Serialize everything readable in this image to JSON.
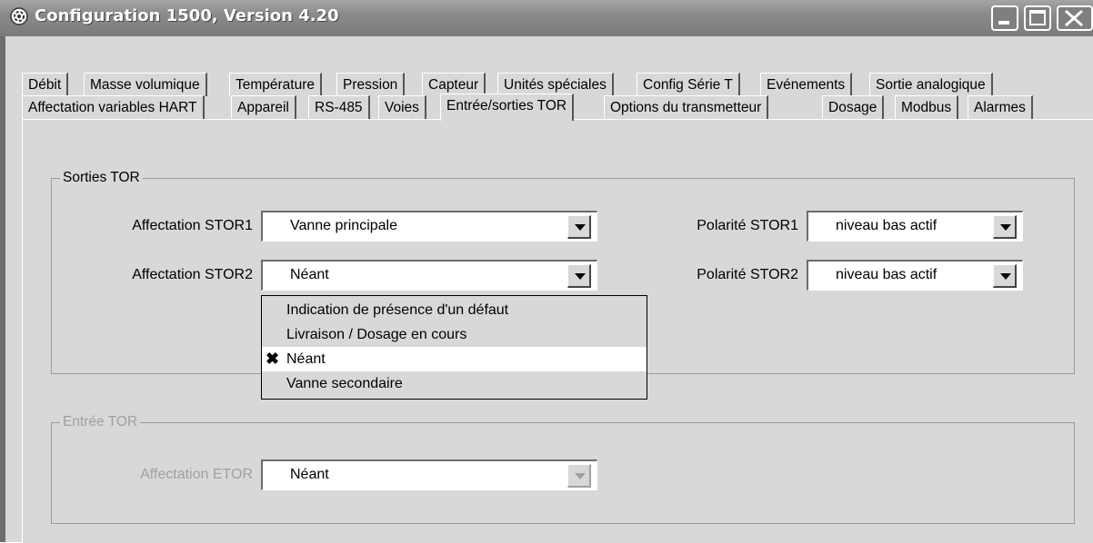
{
  "window": {
    "title": "Configuration 1500, Version 4.20",
    "icon": "gear-icon",
    "buttons": [
      "minimize-icon",
      "maximize-icon",
      "close-icon"
    ]
  },
  "tabs": {
    "row1": [
      "Débit",
      "Masse volumique",
      "Température",
      "Pression",
      "Capteur",
      "Unités spéciales",
      "Config Série T",
      "Evénements",
      "Sortie analogique"
    ],
    "row2": [
      "Affectation variables HART",
      "Appareil",
      "RS-485",
      "Voies",
      "Entrée/sorties TOR",
      "Options du transmetteur",
      "Dosage",
      "Modbus",
      "Alarmes"
    ],
    "active": "Entrée/sorties TOR"
  },
  "sorties": {
    "group_label": "Sorties TOR",
    "stor1_label": "Affectation STOR1",
    "stor1_value": "Vanne principale",
    "stor2_label": "Affectation STOR2",
    "stor2_value": "Néant",
    "pol1_label": "Polarité STOR1",
    "pol1_value": "niveau bas actif",
    "pol2_label": "Polarité STOR2",
    "pol2_value": "niveau bas actif"
  },
  "dropdown": {
    "options": [
      "Indication de présence d'un défaut",
      "Livraison / Dosage en cours",
      "Néant",
      "Vanne secondaire"
    ],
    "selected": "Néant",
    "check_mark": "✖"
  },
  "entree": {
    "group_label": "Entrée TOR",
    "etor_label": "Affectation ETOR",
    "etor_value": "Néant"
  },
  "colors": {
    "titlebar": "#8a8a8a",
    "face": "#d8d8d8",
    "disabled_text": "#a0a0a0"
  }
}
